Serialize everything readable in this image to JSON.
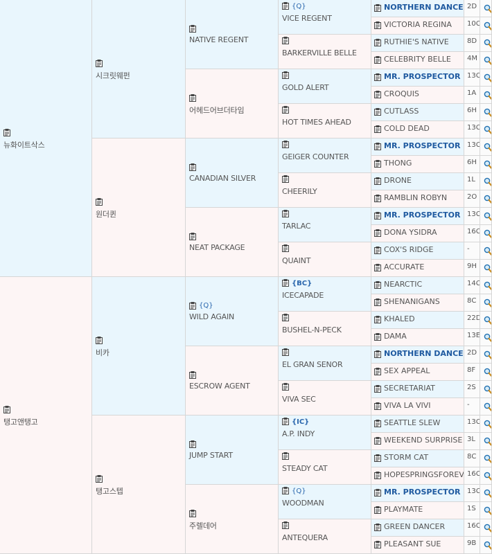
{
  "pedigree": {
    "gen1": [
      {
        "name": "뉴화이트삭스"
      },
      {
        "name": "탱고앤탱고"
      }
    ],
    "gen2": [
      {
        "name": "시크릿웨펀"
      },
      {
        "name": "원더퀸"
      },
      {
        "name": "비카"
      },
      {
        "name": "탱고스텝"
      }
    ],
    "gen3": [
      {
        "name": "NATIVE REGENT",
        "tag": ""
      },
      {
        "name": "어헤드어브더타임",
        "tag": ""
      },
      {
        "name": "CANADIAN SILVER",
        "tag": ""
      },
      {
        "name": "NEAT PACKAGE",
        "tag": ""
      },
      {
        "name": "WILD AGAIN",
        "tag": "{Q}"
      },
      {
        "name": "ESCROW AGENT",
        "tag": ""
      },
      {
        "name": "JUMP START",
        "tag": ""
      },
      {
        "name": "주렐데어",
        "tag": ""
      }
    ],
    "gen4": [
      {
        "name": "VICE REGENT",
        "tag": "{Q}"
      },
      {
        "name": "BARKERVILLE BELLE",
        "tag": ""
      },
      {
        "name": "GOLD ALERT",
        "tag": ""
      },
      {
        "name": "HOT TIMES AHEAD",
        "tag": ""
      },
      {
        "name": "GEIGER COUNTER",
        "tag": ""
      },
      {
        "name": "CHEERILY",
        "tag": ""
      },
      {
        "name": "TARLAC",
        "tag": ""
      },
      {
        "name": "QUAINT",
        "tag": ""
      },
      {
        "name": "ICECAPADE",
        "tag": "{BC}"
      },
      {
        "name": "BUSHEL-N-PECK",
        "tag": ""
      },
      {
        "name": "EL GRAN SENOR",
        "tag": ""
      },
      {
        "name": "VIVA SEC",
        "tag": ""
      },
      {
        "name": "A.P. INDY",
        "tag": "{IC}"
      },
      {
        "name": "STEADY CAT",
        "tag": ""
      },
      {
        "name": "WOODMAN",
        "tag": "{Q}"
      },
      {
        "name": "ANTEQUERA",
        "tag": ""
      }
    ],
    "gen5": [
      {
        "name": "NORTHERN DANCER",
        "code": "2D",
        "highlight": true
      },
      {
        "name": "VICTORIA REGINA",
        "code": "10C",
        "highlight": false
      },
      {
        "name": "RUTHIE'S NATIVE",
        "code": "8D",
        "highlight": false
      },
      {
        "name": "CELEBRITY BELLE",
        "code": "4M",
        "highlight": false
      },
      {
        "name": "MR. PROSPECTOR",
        "code": "13C",
        "highlight": true
      },
      {
        "name": "CROQUIS",
        "code": "1A",
        "highlight": false
      },
      {
        "name": "CUTLASS",
        "code": "6H",
        "highlight": false
      },
      {
        "name": "COLD DEAD",
        "code": "13C",
        "highlight": false
      },
      {
        "name": "MR. PROSPECTOR",
        "code": "13C",
        "highlight": true
      },
      {
        "name": "THONG",
        "code": "6H",
        "highlight": false
      },
      {
        "name": "DRONE",
        "code": "1L",
        "highlight": false
      },
      {
        "name": "RAMBLIN ROBYN",
        "code": "2O",
        "highlight": false
      },
      {
        "name": "MR. PROSPECTOR",
        "code": "13C",
        "highlight": true
      },
      {
        "name": "DONA YSIDRA",
        "code": "16C",
        "highlight": false
      },
      {
        "name": "COX'S RIDGE",
        "code": "-",
        "highlight": false
      },
      {
        "name": "ACCURATE",
        "code": "9H",
        "highlight": false
      },
      {
        "name": "NEARCTIC",
        "code": "14C",
        "highlight": false
      },
      {
        "name": "SHENANIGANS",
        "code": "8C",
        "highlight": false
      },
      {
        "name": "KHALED",
        "code": "22D",
        "highlight": false
      },
      {
        "name": "DAMA",
        "code": "13E",
        "highlight": false
      },
      {
        "name": "NORTHERN DANCER",
        "code": "2D",
        "highlight": true
      },
      {
        "name": "SEX APPEAL",
        "code": "8F",
        "highlight": false
      },
      {
        "name": "SECRETARIAT",
        "code": "2S",
        "highlight": false
      },
      {
        "name": "VIVA LA VIVI",
        "code": "-",
        "highlight": false
      },
      {
        "name": "SEATTLE SLEW",
        "code": "13C",
        "highlight": false
      },
      {
        "name": "WEEKEND SURPRISE",
        "code": "3L",
        "highlight": false
      },
      {
        "name": "STORM CAT",
        "code": "8C",
        "highlight": false
      },
      {
        "name": "HOPESPRINGSFOREVER",
        "code": "16C",
        "highlight": false
      },
      {
        "name": "MR. PROSPECTOR",
        "code": "13C",
        "highlight": true
      },
      {
        "name": "PLAYMATE",
        "code": "1S",
        "highlight": false
      },
      {
        "name": "GREEN DANCER",
        "code": "16C",
        "highlight": false
      },
      {
        "name": "PLEASANT SUE",
        "code": "9B",
        "highlight": false
      }
    ]
  },
  "colors": {
    "male_bg": "#e9f6fd",
    "female_bg": "#fdf5f5",
    "highlight_text": "#1f5aa0",
    "tag_text": "#2a66ad"
  },
  "icons": {
    "record": "clipboard-icon",
    "search": "magnifier-icon"
  }
}
